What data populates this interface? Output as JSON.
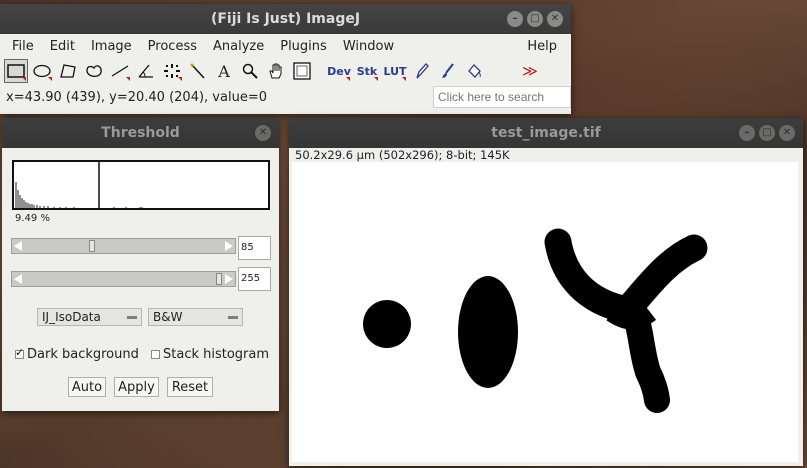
{
  "main_window": {
    "title": "(Fiji Is Just) ImageJ",
    "menus": [
      "File",
      "Edit",
      "Image",
      "Process",
      "Analyze",
      "Plugins",
      "Window"
    ],
    "help": "Help",
    "tools": {
      "dev": "Dev",
      "stk": "Stk",
      "lut": "LUT",
      "text": "A",
      "more": "≫"
    },
    "status": "x=43.90 (439), y=20.40 (204), value=0",
    "search_placeholder": "Click here to search"
  },
  "threshold": {
    "title": "Threshold",
    "percent": "9.49 %",
    "min_value": "85",
    "max_value": "255",
    "min_level": 0.333,
    "max_level": 1.0,
    "method": "IJ_IsoData",
    "display_mode": "B&W",
    "dark_background": {
      "label": "Dark background",
      "checked": true
    },
    "stack_histogram": {
      "label": "Stack histogram",
      "checked": false
    },
    "buttons": {
      "auto": "Auto",
      "apply": "Apply",
      "reset": "Reset"
    }
  },
  "image_window": {
    "title": "test_image.tif",
    "info": "50.2x29.6 µm (502x296); 8-bit; 145K"
  },
  "colors": {
    "titlebar": "#3a3a3a",
    "window_bg": "#efefec",
    "arrow_red": "#c21d1d",
    "tool_blue": "#2a3c8c"
  }
}
